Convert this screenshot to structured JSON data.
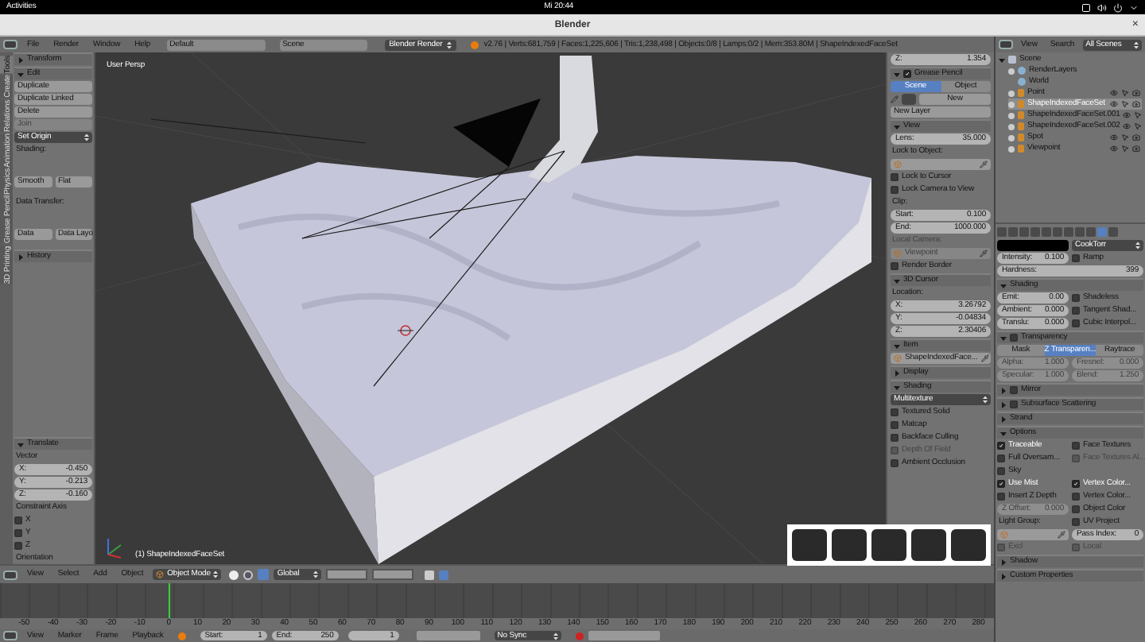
{
  "topbar": {
    "activities": "Activities",
    "clock": "Mi 20:44"
  },
  "window": {
    "title": "Blender",
    "close": "×"
  },
  "info_header": {
    "menus": [
      "File",
      "Render",
      "Window",
      "Help"
    ],
    "layout": "Default",
    "scene": "Scene",
    "engine": "Blender Render",
    "stats": "v2.76 | Verts:681,759 | Faces:1,225,606 | Tris:1,238,498 | Objects:0/8 | Lamps:0/2 | Mem:353.80M | ShapeIndexedFaceSet"
  },
  "tool_tabs": [
    {
      "label": "Tools",
      "selected": true
    },
    {
      "label": "Create",
      "selected": false
    },
    {
      "label": "Relations",
      "selected": false
    },
    {
      "label": "Animation",
      "selected": false
    },
    {
      "label": "Physics",
      "selected": false
    },
    {
      "label": "Grease Pencil",
      "selected": false
    },
    {
      "label": "3D Printing",
      "selected": false
    }
  ],
  "tool_shelf": {
    "items": [
      {
        "kind": "panel",
        "title": "Transform",
        "expanded": false
      },
      {
        "kind": "panel",
        "title": "Edit",
        "expanded": true
      },
      {
        "kind": "button",
        "label": "Duplicate"
      },
      {
        "kind": "button",
        "label": "Duplicate Linked"
      },
      {
        "kind": "button",
        "label": "Delete"
      },
      {
        "kind": "button",
        "label": "Join",
        "disabled": true
      },
      {
        "kind": "dropdown",
        "label": "Set Origin"
      },
      {
        "kind": "label",
        "label": "Shading:"
      },
      {
        "kind": "row",
        "items": [
          {
            "kind": "button",
            "label": "Smooth"
          },
          {
            "kind": "button",
            "label": "Flat"
          }
        ]
      },
      {
        "kind": "label",
        "label": "Data Transfer:"
      },
      {
        "kind": "row",
        "items": [
          {
            "kind": "button",
            "label": "Data"
          },
          {
            "kind": "button",
            "label": "Data Layo"
          }
        ]
      },
      {
        "kind": "panel",
        "title": "History",
        "expanded": false
      }
    ]
  },
  "operator_panel": {
    "items": [
      {
        "kind": "panel",
        "title": "Translate",
        "expanded": true
      },
      {
        "kind": "label",
        "label": "Vector"
      },
      {
        "kind": "field",
        "label": "X:",
        "value": "-0.450"
      },
      {
        "kind": "field",
        "label": "Y:",
        "value": "-0.213"
      },
      {
        "kind": "field",
        "label": "Z:",
        "value": "-0.160"
      },
      {
        "kind": "label",
        "label": "Constraint Axis"
      },
      {
        "kind": "check",
        "label": "X",
        "checked": false
      },
      {
        "kind": "check",
        "label": "Y",
        "checked": false
      },
      {
        "kind": "check",
        "label": "Z",
        "checked": false
      },
      {
        "kind": "label",
        "label": "Orientation"
      }
    ]
  },
  "viewport": {
    "view_name": "User Persp",
    "object_name": "(1) ShapeIndexedFaceSet"
  },
  "n_panel": {
    "items": [
      {
        "kind": "field",
        "label": "Z:",
        "value": "1.354"
      },
      {
        "kind": "panel",
        "title": "Grease Pencil",
        "expanded": true,
        "checkbox": true
      },
      {
        "kind": "tabs",
        "items": [
          {
            "label": "Scene",
            "selected": true
          },
          {
            "label": "Object",
            "selected": false
          }
        ]
      },
      {
        "kind": "datablock",
        "button": "New"
      },
      {
        "kind": "button",
        "label": "New Layer"
      },
      {
        "kind": "panel",
        "title": "View",
        "expanded": true
      },
      {
        "kind": "field",
        "label": "Lens:",
        "value": "35.000"
      },
      {
        "kind": "label",
        "label": "Lock to Object:"
      },
      {
        "kind": "picker"
      },
      {
        "kind": "check",
        "label": "Lock to Cursor",
        "checked": false
      },
      {
        "kind": "check",
        "label": "Lock Camera to View",
        "checked": false
      },
      {
        "kind": "label",
        "label": "Clip:"
      },
      {
        "kind": "field",
        "label": "Start:",
        "value": "0.100"
      },
      {
        "kind": "field",
        "label": "End:",
        "value": "1000.000"
      },
      {
        "kind": "label",
        "label": "Local Camera:",
        "disabled": true
      },
      {
        "kind": "picker",
        "value": "Viewpoint",
        "disabled": true
      },
      {
        "kind": "check",
        "label": "Render Border",
        "checked": false
      },
      {
        "kind": "panel",
        "title": "3D Cursor",
        "expanded": true
      },
      {
        "kind": "label",
        "label": "Location:"
      },
      {
        "kind": "field",
        "label": "X:",
        "value": "3.26792"
      },
      {
        "kind": "field",
        "label": "Y:",
        "value": "-0.04834"
      },
      {
        "kind": "field",
        "label": "Z:",
        "value": "2.30406"
      },
      {
        "kind": "panel",
        "title": "Item",
        "expanded": true
      },
      {
        "kind": "picker",
        "value": "ShapeIndexedFace..."
      },
      {
        "kind": "panel",
        "title": "Display",
        "expanded": false
      },
      {
        "kind": "panel",
        "title": "Shading",
        "expanded": true
      },
      {
        "kind": "dropdown",
        "label": "Multitexture"
      },
      {
        "kind": "check",
        "label": "Textured Solid",
        "checked": false
      },
      {
        "kind": "check",
        "label": "Matcap",
        "checked": false
      },
      {
        "kind": "check",
        "label": "Backface Culling",
        "checked": false
      },
      {
        "kind": "check",
        "label": "Depth Of Field",
        "checked": false,
        "disabled": true
      },
      {
        "kind": "check",
        "label": "Ambient Occlusion",
        "checked": false
      }
    ]
  },
  "view3d_header": {
    "menus": [
      "View",
      "Select",
      "Add",
      "Object"
    ],
    "mode": "Object Mode",
    "orientation": "Global"
  },
  "timeline": {
    "ruler": [
      "-50",
      "-40",
      "-30",
      "-20",
      "-10",
      "0",
      "10",
      "20",
      "30",
      "40",
      "50",
      "60",
      "70",
      "80",
      "90",
      "100",
      "110",
      "120",
      "130",
      "140",
      "150",
      "160",
      "170",
      "180",
      "190",
      "200",
      "210",
      "220",
      "230",
      "240",
      "250",
      "260",
      "270",
      "280"
    ],
    "menus": [
      "View",
      "Marker",
      "Frame",
      "Playback"
    ],
    "start": {
      "label": "Start:",
      "value": "1"
    },
    "end": {
      "label": "End:",
      "value": "250"
    },
    "frame": "1",
    "sync": "No Sync"
  },
  "outliner": {
    "menus": [
      "View",
      "Search"
    ],
    "filter": "All Scenes",
    "tree": [
      {
        "label": "Scene",
        "kind": "scene",
        "expanded": true,
        "selected": false,
        "children": [
          {
            "label": "RenderLayers",
            "kind": "data",
            "expanded": false,
            "selected": false
          },
          {
            "label": "World",
            "kind": "data",
            "selected": false
          },
          {
            "label": "Point",
            "kind": "object",
            "expanded": false,
            "selected": false
          },
          {
            "label": "ShapeIndexedFaceSet",
            "kind": "object",
            "expanded": false,
            "selected": true
          },
          {
            "label": "ShapeIndexedFaceSet.001",
            "kind": "object",
            "expanded": false,
            "selected": false
          },
          {
            "label": "ShapeIndexedFaceSet.002",
            "kind": "object",
            "expanded": false,
            "selected": false
          },
          {
            "label": "Spot",
            "kind": "object",
            "expanded": false,
            "selected": false
          },
          {
            "label": "Viewpoint",
            "kind": "object",
            "expanded": false,
            "selected": false
          }
        ]
      }
    ]
  },
  "property_tabs": [
    {
      "selected": false
    },
    {
      "selected": false
    },
    {
      "selected": false
    },
    {
      "selected": false
    },
    {
      "selected": false
    },
    {
      "selected": false
    },
    {
      "selected": false
    },
    {
      "selected": false
    },
    {
      "selected": false
    },
    {
      "selected": true
    },
    {
      "selected": false
    }
  ],
  "properties": {
    "items": [
      {
        "kind": "row",
        "items": [
          {
            "kind": "swatch"
          },
          {
            "kind": "dropdown",
            "label": "CookTorr"
          }
        ]
      },
      {
        "kind": "row",
        "items": [
          {
            "kind": "field",
            "label": "Intensity:",
            "value": "0.100"
          },
          {
            "kind": "check",
            "label": "Ramp",
            "checked": false
          }
        ]
      },
      {
        "kind": "field",
        "label": "Hardness:",
        "value": "399"
      },
      {
        "kind": "panel",
        "title": "Shading",
        "expanded": true
      },
      {
        "kind": "row",
        "items": [
          {
            "kind": "field",
            "label": "Emit:",
            "value": "0.00"
          },
          {
            "kind": "check",
            "label": "Shadeless",
            "checked": false
          }
        ]
      },
      {
        "kind": "row",
        "items": [
          {
            "kind": "field",
            "label": "Ambient:",
            "value": "0.000"
          },
          {
            "kind": "check",
            "label": "Tangent Shad...",
            "checked": false
          }
        ]
      },
      {
        "kind": "row",
        "items": [
          {
            "kind": "field",
            "label": "Translu:",
            "value": "0.000"
          },
          {
            "kind": "check",
            "label": "Cubic Interpol...",
            "checked": false
          }
        ]
      },
      {
        "kind": "panel",
        "title": "Transparency",
        "expanded": true,
        "checkbox": false
      },
      {
        "kind": "tabs",
        "items": [
          {
            "label": "Mask",
            "selected": false
          },
          {
            "label": "Z Transparen...",
            "selected": true
          },
          {
            "label": "Raytrace",
            "selected": false
          }
        ]
      },
      {
        "kind": "row",
        "items": [
          {
            "kind": "field",
            "label": "Alpha:",
            "value": "1.000",
            "disabled": true
          },
          {
            "kind": "field",
            "label": "Fresnel:",
            "value": "0.000",
            "disabled": true
          }
        ]
      },
      {
        "kind": "row",
        "items": [
          {
            "kind": "field",
            "label": "Specular:",
            "value": "1.000",
            "disabled": true
          },
          {
            "kind": "field",
            "label": "Blend:",
            "value": "1.250",
            "disabled": true
          }
        ]
      },
      {
        "kind": "panel",
        "title": "Mirror",
        "expanded": false,
        "checkbox": false
      },
      {
        "kind": "panel",
        "title": "Subsurface Scattering",
        "expanded": false,
        "checkbox": false
      },
      {
        "kind": "panel",
        "title": "Strand",
        "expanded": false
      },
      {
        "kind": "panel",
        "title": "Options",
        "expanded": true
      },
      {
        "kind": "row",
        "items": [
          {
            "kind": "check",
            "label": "Traceable",
            "checked": true
          },
          {
            "kind": "check",
            "label": "Face Textures",
            "checked": false
          }
        ]
      },
      {
        "kind": "row",
        "items": [
          {
            "kind": "check",
            "label": "Full Oversam...",
            "checked": false
          },
          {
            "kind": "check",
            "label": "Face Textures Al...",
            "checked": false,
            "disabled": true
          }
        ]
      },
      {
        "kind": "row",
        "items": [
          {
            "kind": "check",
            "label": "Sky",
            "checked": false
          }
        ]
      },
      {
        "kind": "row",
        "items": [
          {
            "kind": "check",
            "label": "Use Mist",
            "checked": true
          },
          {
            "kind": "check",
            "label": "Vertex Color...",
            "checked": true
          }
        ]
      },
      {
        "kind": "row",
        "items": [
          {
            "kind": "check",
            "label": "Insert Z Depth",
            "checked": false
          },
          {
            "kind": "check",
            "label": "Vertex Color...",
            "checked": false
          }
        ]
      },
      {
        "kind": "row",
        "items": [
          {
            "kind": "field",
            "label": "Z Offset:",
            "value": "0.000",
            "disabled": true
          },
          {
            "kind": "check",
            "label": "Object Color",
            "checked": false
          }
        ]
      },
      {
        "kind": "row",
        "items": [
          {
            "kind": "label",
            "label": "Light Group:"
          },
          {
            "kind": "check",
            "label": "UV Project",
            "checked": false
          }
        ]
      },
      {
        "kind": "row",
        "items": [
          {
            "kind": "picker"
          },
          {
            "kind": "field",
            "label": "Pass Index:",
            "value": "0"
          }
        ]
      },
      {
        "kind": "row",
        "items": [
          {
            "kind": "check",
            "label": "Excl",
            "checked": false,
            "disabled": true
          },
          {
            "kind": "check",
            "label": "Local",
            "checked": false,
            "disabled": true
          }
        ]
      },
      {
        "kind": "panel",
        "title": "Shadow",
        "expanded": false
      },
      {
        "kind": "panel",
        "title": "Custom Properties",
        "expanded": false
      }
    ]
  }
}
